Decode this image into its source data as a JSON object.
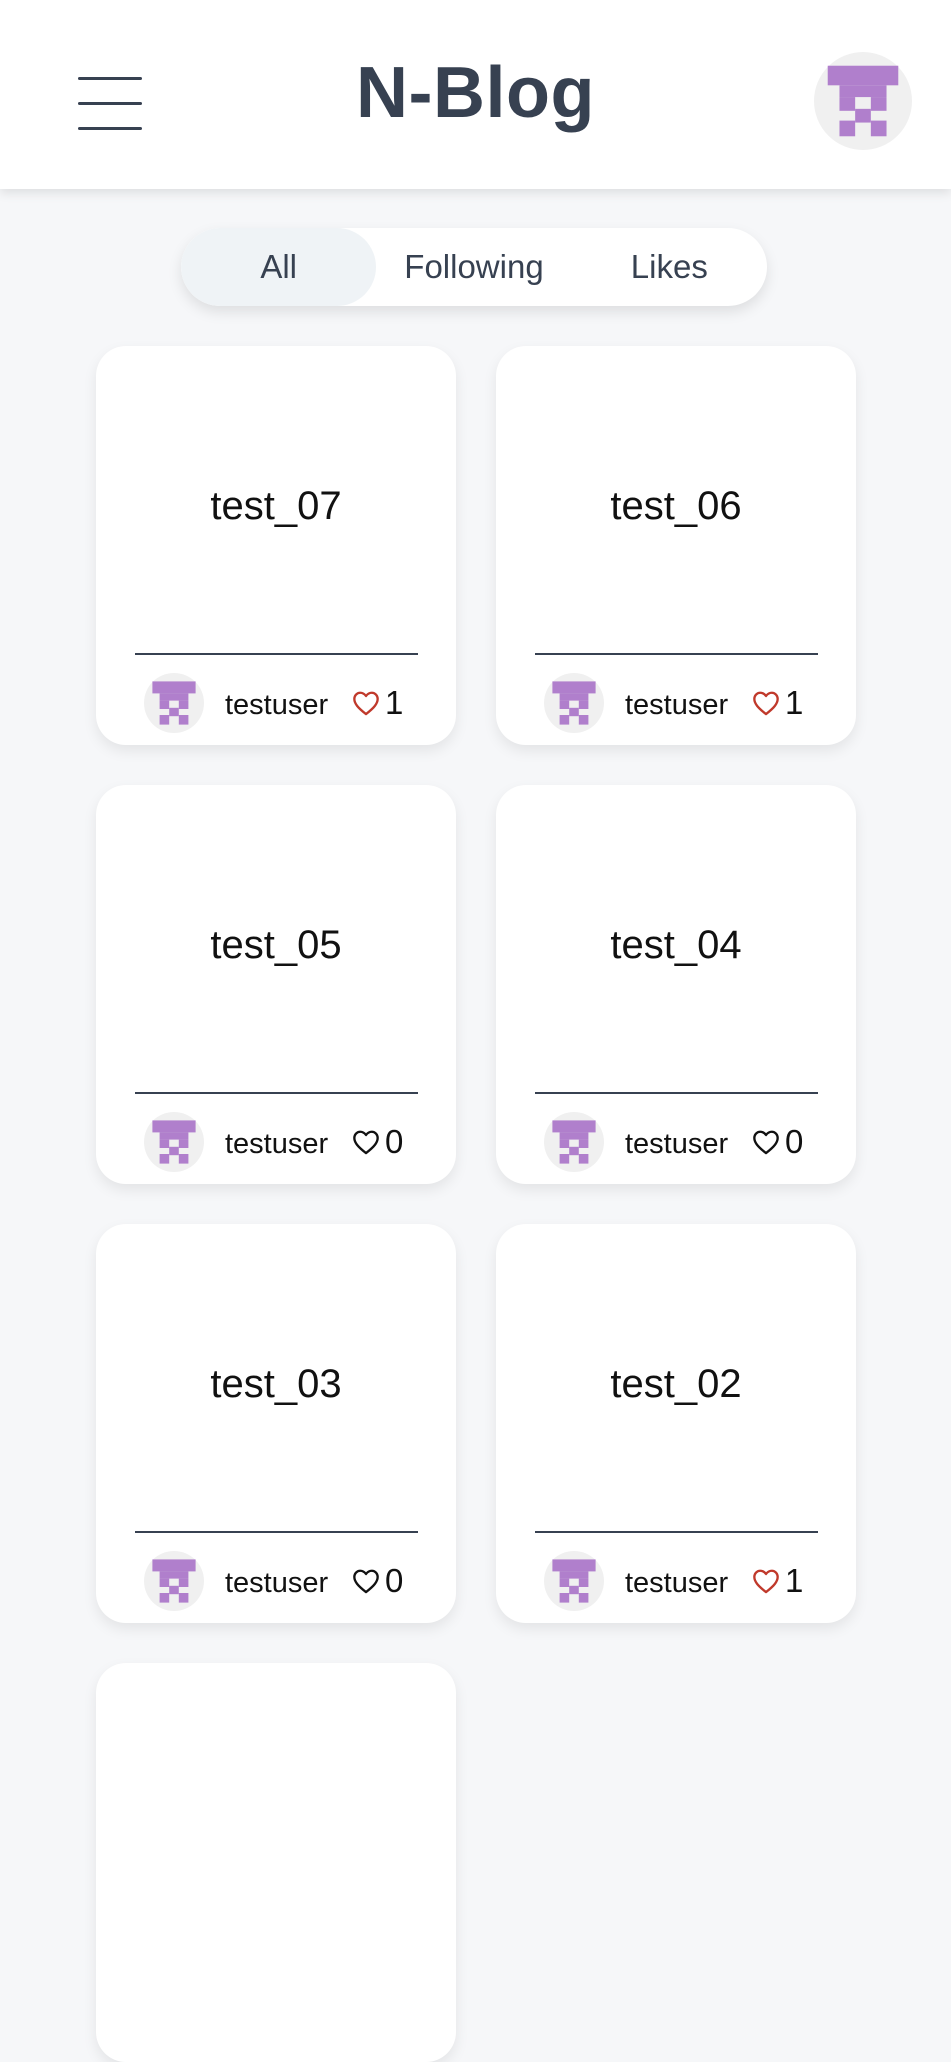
{
  "header": {
    "title": "N-Blog"
  },
  "tabs": [
    {
      "label": "All",
      "active": true
    },
    {
      "label": "Following",
      "active": false
    },
    {
      "label": "Likes",
      "active": false
    }
  ],
  "posts": [
    {
      "title": "test_07",
      "author": "testuser",
      "likes": "1",
      "liked": true
    },
    {
      "title": "test_06",
      "author": "testuser",
      "likes": "1",
      "liked": true
    },
    {
      "title": "test_05",
      "author": "testuser",
      "likes": "0",
      "liked": false
    },
    {
      "title": "test_04",
      "author": "testuser",
      "likes": "0",
      "liked": false
    },
    {
      "title": "test_03",
      "author": "testuser",
      "likes": "0",
      "liked": false
    },
    {
      "title": "test_02",
      "author": "testuser",
      "likes": "1",
      "liked": true
    },
    {
      "title": "",
      "author": "",
      "likes": "",
      "liked": false
    }
  ],
  "icons": {
    "menu": "hamburger-menu-icon",
    "avatar": "identicon-avatar",
    "like": "heart-icon"
  },
  "colors": {
    "title": "#374151",
    "avatar_fg": "#b07fcc",
    "avatar_bg": "#f0f0f0",
    "heart_liked": "#c0392b",
    "heart_unliked": "#111111",
    "page_bg": "#f6f7f9"
  }
}
